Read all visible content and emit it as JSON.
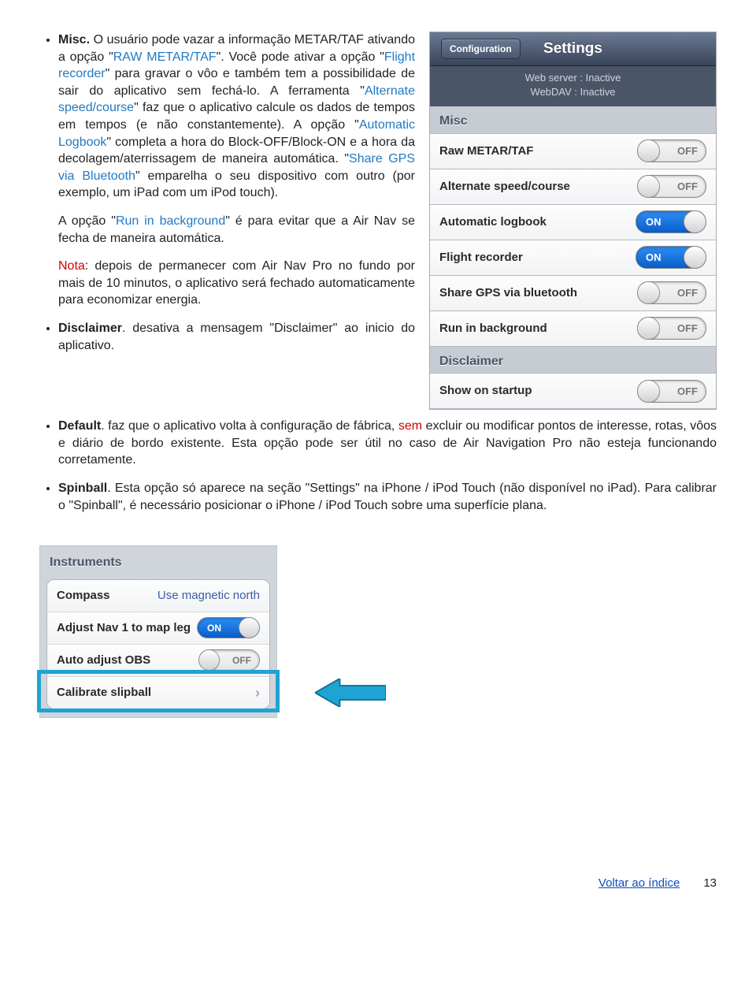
{
  "doc": {
    "misc_title": "Misc.",
    "misc_body_1": " O usuário pode vazar a informação METAR/TAF ativando a opção \"",
    "misc_raw": "RAW METAR/TAF",
    "misc_body_2": "\". Você pode ativar a opção \"",
    "misc_flightrec": "Flight recorder",
    "misc_body_3": "\" para gravar o vôo e também tem a possibilidade de sair do aplicativo sem fechá-lo. A ferramenta \"",
    "misc_altspeed": "Alternate speed/course",
    "misc_body_4": "\" faz que o aplicativo calcule os dados de tempos em tempos (e não constantemente). A opção \"",
    "misc_autolog": "Automatic Logbook",
    "misc_body_5": "\" completa a hora do Block-OFF/Block-ON e a hora da decolagem/aterrissagem de maneira automática. \"",
    "misc_sharegps": "Share GPS via Bluetooth",
    "misc_body_6": "\" emparelha o seu dispositivo com outro (por exemplo, um iPad com um iPod touch).",
    "misc_runbg_1": "A opção \"",
    "misc_runbg": "Run in background",
    "misc_runbg_2": "\" é para evitar que a Air Nav se fecha de maneira automática.",
    "nota_label": "Nota",
    "nota_body": ": depois de permanecer com Air Nav Pro no fundo por mais de 10 minutos, o aplicativo será fechado automaticamente para economizar energia.",
    "disclaimer_title": "Disclaimer",
    "disclaimer_body": ". desativa a mensagem \"Disclaimer\" ao inicio do aplicativo.",
    "default_title": "Default",
    "default_body_1": ". faz que o aplicativo volta à configuração de fábrica, ",
    "default_sem": "sem",
    "default_body_2": " excluir ou modificar pontos de interesse, rotas, vôos e diário de bordo existente. Esta opção pode ser útil no caso de Air Navigation Pro não esteja funcionando corretamente.",
    "spinball_title": "Spinball",
    "spinball_body": ". Esta opção só aparece na seção \"Settings\" na iPhone / iPod Touch (não disponível no iPad). Para calibrar o \"Spinball\", é necessário posicionar o iPhone / iPod Touch sobre uma superfície plana."
  },
  "settings": {
    "back": "Configuration",
    "title": "Settings",
    "status1": "Web server : Inactive",
    "status2": "WebDAV : Inactive",
    "section_misc": "Misc",
    "rows": [
      {
        "label": "Raw METAR/TAF",
        "state": "off",
        "txt": "OFF"
      },
      {
        "label": "Alternate speed/course",
        "state": "off",
        "txt": "OFF"
      },
      {
        "label": "Automatic logbook",
        "state": "on",
        "txt": "ON"
      },
      {
        "label": "Flight recorder",
        "state": "on",
        "txt": "ON"
      },
      {
        "label": "Share GPS via bluetooth",
        "state": "off",
        "txt": "OFF"
      },
      {
        "label": "Run in background",
        "state": "off",
        "txt": "OFF"
      }
    ],
    "section_disc": "Disclaimer",
    "disc_row_label": "Show on startup",
    "disc_row_txt": "OFF"
  },
  "instruments": {
    "section": "Instruments",
    "compass_label": "Compass",
    "compass_value": "Use magnetic north",
    "adjust_label": "Adjust Nav 1 to map leg",
    "adjust_txt": "ON",
    "obs_label": "Auto adjust OBS",
    "obs_txt": "OFF",
    "calibrate_label": "Calibrate slipball"
  },
  "footer": {
    "link": "Voltar ao índice",
    "page": "13"
  }
}
